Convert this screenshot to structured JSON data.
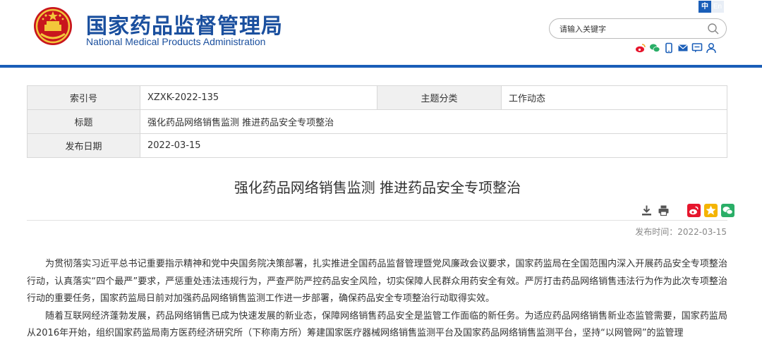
{
  "header": {
    "title_cn": "国家药品监督管理局",
    "title_en": "National Medical Products Administration",
    "lang_zh": "中",
    "lang_en": "En",
    "search_placeholder": "请输入关键字",
    "social_icons": [
      "weibo-icon",
      "wechat-icon",
      "mobile-icon",
      "mail-icon",
      "message-icon",
      "user-icon"
    ]
  },
  "colors": {
    "brand_blue": "#1a4f9e",
    "bar_blue": "#1a5eb8",
    "label_bg": "#f0f0f0"
  },
  "info": {
    "index_label": "索引号",
    "index_value": "XZXK-2022-135",
    "category_label": "主题分类",
    "category_value": "工作动态",
    "title_label": "标题",
    "title_value": "强化药品网络销售监测 推进药品安全专项整治",
    "date_label": "发布日期",
    "date_value": "2022-03-15"
  },
  "article": {
    "title": "强化药品网络销售监测 推进药品安全专项整治",
    "pubdate": "发布时间：2022-03-15",
    "paragraphs": [
      "为贯彻落实习近平总书记重要指示精神和党中央国务院决策部署，扎实推进全国药品监督管理暨党风廉政会议要求，国家药监局在全国范围内深入开展药品安全专项整治行动，认真落实“四个最严”要求，严惩重处违法违规行为，严查严防严控药品安全风险，切实保障人民群众用药安全有效。严厉打击药品网络销售违法行为作为此次专项整治行动的重要任务，国家药监局日前对加强药品网络销售监测工作进一步部署，确保药品安全专项整治行动取得实效。",
      "随着互联网经济蓬勃发展，药品网络销售已成为快速发展的新业态，保障网络销售药品安全是监管工作面临的新任务。为适应药品网络销售新业态监管需要，国家药监局从2016年开始，组织国家药监局南方医药经济研究所（下称南方所）筹建国家医疗器械网络销售监测平台及国家药品网络销售监测平台，坚持“以网管网”的监管理"
    ]
  }
}
